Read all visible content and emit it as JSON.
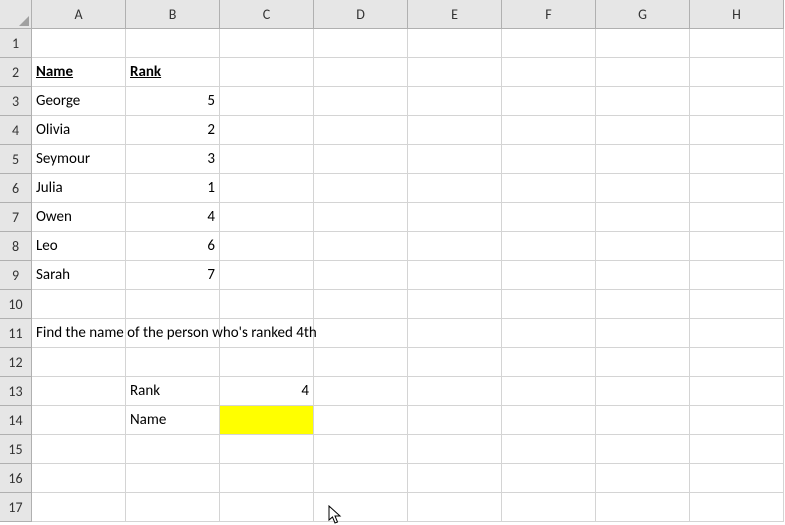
{
  "columns": [
    "A",
    "B",
    "C",
    "D",
    "E",
    "F",
    "G",
    "H"
  ],
  "rows": [
    "1",
    "2",
    "3",
    "4",
    "5",
    "6",
    "7",
    "8",
    "9",
    "10",
    "11",
    "12",
    "13",
    "14",
    "15",
    "16",
    "17"
  ],
  "headers": {
    "name": "Name",
    "rank": "Rank"
  },
  "data": [
    {
      "name": "George",
      "rank": "5"
    },
    {
      "name": "Olivia",
      "rank": "2"
    },
    {
      "name": "Seymour",
      "rank": "3"
    },
    {
      "name": "Julia",
      "rank": "1"
    },
    {
      "name": "Owen",
      "rank": "4"
    },
    {
      "name": "Leo",
      "rank": "6"
    },
    {
      "name": "Sarah",
      "rank": "7"
    }
  ],
  "instruction": "Find the name of the person who's ranked 4th",
  "lookup": {
    "rank_label": "Rank",
    "rank_value": "4",
    "name_label": "Name",
    "name_value": ""
  }
}
